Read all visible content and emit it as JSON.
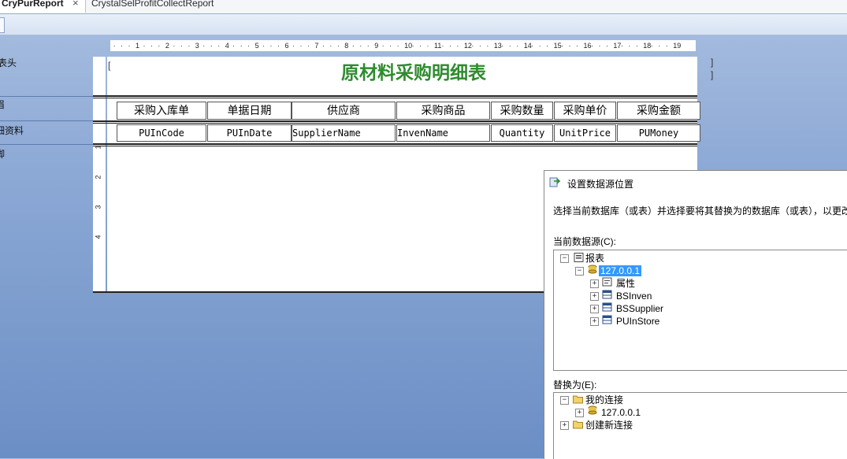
{
  "tabs": [
    {
      "label": "CryPurReport",
      "close": "×"
    },
    {
      "label": "CrystalSelProfitCollectReport"
    }
  ],
  "sections": [
    "表头",
    "眉",
    "细资料",
    "脚"
  ],
  "ruler_labels": [
    "1",
    "2",
    "3",
    "4",
    "5",
    "6",
    "7",
    "8",
    "9",
    "10",
    "11",
    "12",
    "13",
    "14",
    "15",
    "16",
    "17",
    "18",
    "19"
  ],
  "vruler_labels": [
    "1",
    "2",
    "3",
    "4"
  ],
  "report": {
    "title": "原材料采购明细表",
    "headers": [
      "采购入库单",
      "单据日期",
      "供应商",
      "采购商品",
      "采购数量",
      "采购单价",
      "采购金额"
    ],
    "fields": [
      "PUInCode",
      "PUInDate",
      "SupplierName",
      "InvenName",
      "Quantity",
      "UnitPrice",
      "PUMoney"
    ]
  },
  "dialog": {
    "title": "设置数据源位置",
    "description": "选择当前数据库（或表）并选择要将其替换为的数据库（或表），以更改",
    "current_label": "当前数据源(C):",
    "current_tree": {
      "root": "报表",
      "server": "127.0.0.1",
      "children": [
        "属性",
        "BSInven",
        "BSSupplier",
        "PUInStore"
      ]
    },
    "replace_label": "替换为(E):",
    "replace_tree": {
      "my_connections": "我的连接",
      "server": "127.0.0.1",
      "new_connection": "创建新连接"
    }
  },
  "colors": {
    "title_green": "#2e8b2e",
    "selection": "#3399ff"
  }
}
